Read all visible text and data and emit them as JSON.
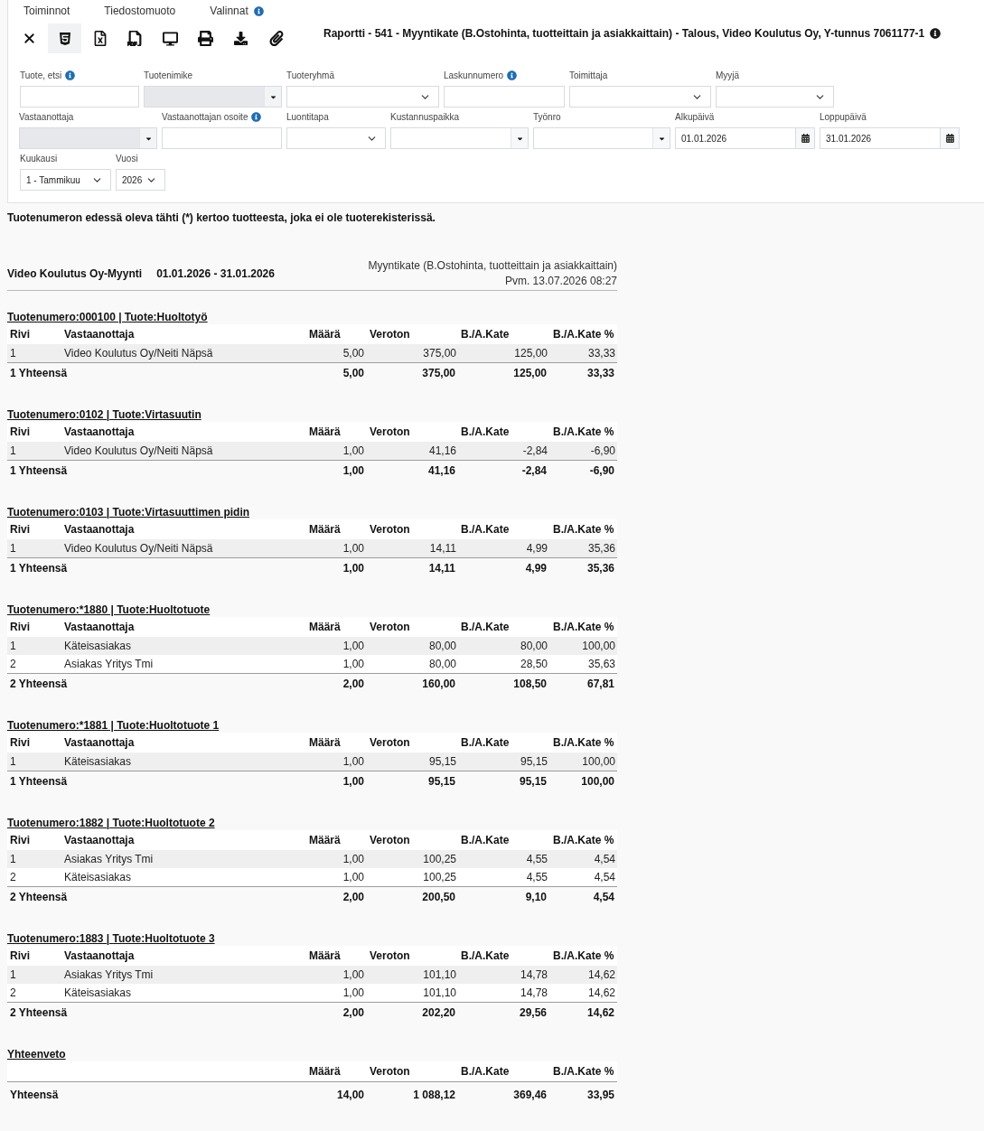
{
  "menu": [
    {
      "label": "Toiminnot",
      "info": false
    },
    {
      "label": "Tiedostomuoto",
      "info": false
    },
    {
      "label": "Valinnat",
      "info": true
    }
  ],
  "toolbar": [
    {
      "kind": "close",
      "selected": false
    },
    {
      "kind": "html",
      "selected": true
    },
    {
      "kind": "excel",
      "selected": false
    },
    {
      "kind": "pdf",
      "selected": false
    },
    {
      "kind": "screen",
      "selected": false
    },
    {
      "kind": "print",
      "selected": false
    },
    {
      "kind": "download",
      "selected": false
    },
    {
      "kind": "attach",
      "selected": false
    }
  ],
  "title": {
    "text": "Raportti - 541 - Myyntikate (B.Ostohinta, tuotteittain ja asiakkaittain) - Talous, Video Koulutus Oy, Y-tunnus 7061177-1",
    "info": true
  },
  "filters": [
    {
      "fields": [
        {
          "label": "Tuote, etsi",
          "info": true,
          "kind": "text",
          "disabled": false
        },
        {
          "label": "Tuotenimike",
          "info": false,
          "kind": "combo",
          "disabled": true
        },
        {
          "label": "Tuoteryhmä",
          "info": false,
          "kind": "select",
          "disabled": false
        },
        {
          "label": "Laskunnumero",
          "info": true,
          "kind": "text",
          "disabled": false
        },
        {
          "label": "Toimittaja",
          "info": false,
          "kind": "select",
          "disabled": false
        },
        {
          "label": "Myyjä",
          "info": false,
          "kind": "select",
          "disabled": false
        }
      ]
    },
    {
      "fields": [
        {
          "label": "Vastaanottaja",
          "info": false,
          "kind": "combo",
          "disabled": true
        },
        {
          "label": "Vastaanottajan osoite",
          "info": true,
          "kind": "text",
          "disabled": false
        },
        {
          "label": "Luontitapa",
          "info": false,
          "kind": "select",
          "disabled": false
        },
        {
          "label": "Kustannuspaikka",
          "info": false,
          "kind": "combo",
          "disabled": false
        },
        {
          "label": "Työnro",
          "info": false,
          "kind": "combo",
          "disabled": false
        },
        {
          "label": "Alkupäivä",
          "info": false,
          "kind": "date",
          "disabled": false,
          "value": "01.01.2026"
        },
        {
          "label": "Loppupäivä",
          "info": false,
          "kind": "date",
          "disabled": false,
          "value": "31.01.2026"
        }
      ]
    },
    {
      "fields": [
        {
          "label": "Kuukausi",
          "info": false,
          "kind": "select",
          "disabled": false,
          "value": "1 - Tammikuu"
        },
        {
          "label": "Vuosi",
          "info": false,
          "kind": "select",
          "disabled": false,
          "value": "2026"
        }
      ]
    }
  ],
  "note": "Tuotenumeron edessä oleva tähti (*) kertoo tuotteesta, joka ei ole tuoterekisterissä.",
  "report": {
    "company": "Video Koulutus Oy-Myynti",
    "period": "01.01.2026 - 31.01.2026",
    "name": "Myyntikate (B.Ostohinta, tuotteittain ja asiakkaittain)",
    "printed": "Pvm. 13.07.2026 08:27"
  },
  "groups": [
    {
      "heading": "Tuotenumero:000100 | Tuote:Huoltotyö",
      "columns": [
        "Rivi",
        "Vastaanottaja",
        "Määrä",
        "Veroton",
        "B./A.Kate",
        "B./A.Kate %"
      ],
      "rows": [
        [
          "1",
          "Video Koulutus Oy/Neiti Näpsä",
          "5,00",
          "375,00",
          "125,00",
          "33,33"
        ]
      ],
      "total": [
        "1 Yhteensä",
        "5,00",
        "375,00",
        "125,00",
        "33,33"
      ]
    },
    {
      "heading": "Tuotenumero:0102 | Tuote:Virtasuutin",
      "columns": [
        "Rivi",
        "Vastaanottaja",
        "Määrä",
        "Veroton",
        "B./A.Kate",
        "B./A.Kate %"
      ],
      "rows": [
        [
          "1",
          "Video Koulutus Oy/Neiti Näpsä",
          "1,00",
          "41,16",
          "-2,84",
          "-6,90"
        ]
      ],
      "total": [
        "1 Yhteensä",
        "1,00",
        "41,16",
        "-2,84",
        "-6,90"
      ]
    },
    {
      "heading": "Tuotenumero:0103 | Tuote:Virtasuuttimen pidin",
      "columns": [
        "Rivi",
        "Vastaanottaja",
        "Määrä",
        "Veroton",
        "B./A.Kate",
        "B./A.Kate %"
      ],
      "rows": [
        [
          "1",
          "Video Koulutus Oy/Neiti Näpsä",
          "1,00",
          "14,11",
          "4,99",
          "35,36"
        ]
      ],
      "total": [
        "1 Yhteensä",
        "1,00",
        "14,11",
        "4,99",
        "35,36"
      ]
    },
    {
      "heading": "Tuotenumero:*1880 | Tuote:Huoltotuote",
      "columns": [
        "Rivi",
        "Vastaanottaja",
        "Määrä",
        "Veroton",
        "B./A.Kate",
        "B./A.Kate %"
      ],
      "rows": [
        [
          "1",
          "Käteisasiakas",
          "1,00",
          "80,00",
          "80,00",
          "100,00"
        ],
        [
          "2",
          "Asiakas Yritys Tmi",
          "1,00",
          "80,00",
          "28,50",
          "35,63"
        ]
      ],
      "total": [
        "2 Yhteensä",
        "2,00",
        "160,00",
        "108,50",
        "67,81"
      ]
    },
    {
      "heading": "Tuotenumero:*1881 | Tuote:Huoltotuote 1",
      "columns": [
        "Rivi",
        "Vastaanottaja",
        "Määrä",
        "Veroton",
        "B./A.Kate",
        "B./A.Kate %"
      ],
      "rows": [
        [
          "1",
          "Käteisasiakas",
          "1,00",
          "95,15",
          "95,15",
          "100,00"
        ]
      ],
      "total": [
        "1 Yhteensä",
        "1,00",
        "95,15",
        "95,15",
        "100,00"
      ]
    },
    {
      "heading": "Tuotenumero:1882 | Tuote:Huoltotuote 2",
      "columns": [
        "Rivi",
        "Vastaanottaja",
        "Määrä",
        "Veroton",
        "B./A.Kate",
        "B./A.Kate %"
      ],
      "rows": [
        [
          "1",
          "Asiakas Yritys Tmi",
          "1,00",
          "100,25",
          "4,55",
          "4,54"
        ],
        [
          "2",
          "Käteisasiakas",
          "1,00",
          "100,25",
          "4,55",
          "4,54"
        ]
      ],
      "total": [
        "2 Yhteensä",
        "2,00",
        "200,50",
        "9,10",
        "4,54"
      ]
    },
    {
      "heading": "Tuotenumero:1883 | Tuote:Huoltotuote 3",
      "columns": [
        "Rivi",
        "Vastaanottaja",
        "Määrä",
        "Veroton",
        "B./A.Kate",
        "B./A.Kate %"
      ],
      "rows": [
        [
          "1",
          "Asiakas Yritys Tmi",
          "1,00",
          "101,10",
          "14,78",
          "14,62"
        ],
        [
          "2",
          "Käteisasiakas",
          "1,00",
          "101,10",
          "14,78",
          "14,62"
        ]
      ],
      "total": [
        "2 Yhteensä",
        "2,00",
        "202,20",
        "29,56",
        "14,62"
      ]
    }
  ],
  "summary": {
    "heading": "Yhteenveto",
    "columns": [
      "Määrä",
      "Veroton",
      "B./A.Kate",
      "B./A.Kate %"
    ],
    "total": [
      "Yhteensä",
      "14,00",
      "1 088,12",
      "369,46",
      "33,95"
    ]
  }
}
